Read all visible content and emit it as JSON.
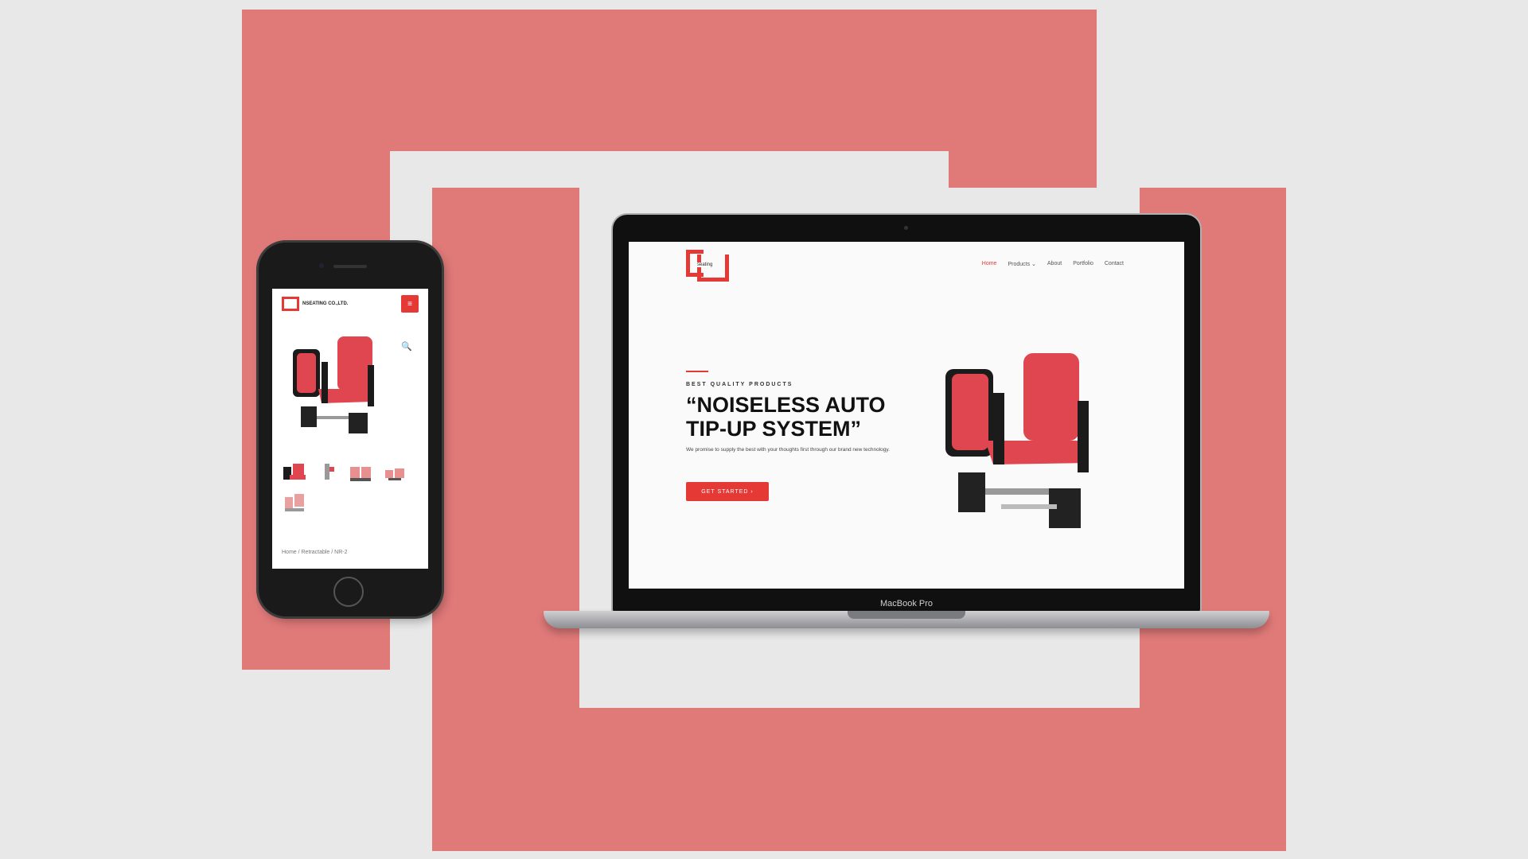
{
  "colors": {
    "accent": "#e53935",
    "background_frame": "#e07a79",
    "background": "#e8e8e8"
  },
  "laptop": {
    "device_label": "MacBook Pro",
    "site": {
      "logo_text": "seating",
      "nav": [
        "Home",
        "Products ⌄",
        "About",
        "Portfolio",
        "Contact"
      ],
      "hero": {
        "eyebrow": "BEST QUALITY PRODUCTS",
        "title": "“NOISELESS AUTO TIP-UP SYSTEM”",
        "text": "We promise to supply the best with your thoughts first through our brand new technology.",
        "button": "GET STARTED ›"
      }
    }
  },
  "phone": {
    "brand": "NSEATING CO.,LTD.",
    "menu_icon": "hamburger-icon",
    "zoom_icon": "magnifier-icon",
    "breadcrumb": "Home / Retractable / NR-2"
  }
}
